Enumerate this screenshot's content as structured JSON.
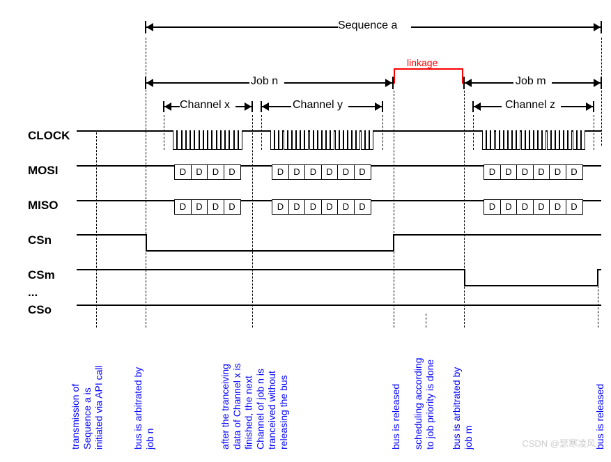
{
  "sequence_label": "Sequence a",
  "job_n_label": "Job n",
  "job_m_label": "Job m",
  "linkage_label": "linkage",
  "channel_x_label": "Channel x",
  "channel_y_label": "Channel y",
  "channel_z_label": "Channel z",
  "signals": {
    "clock": "CLOCK",
    "mosi": "MOSI",
    "miso": "MISO",
    "csn": "CSn",
    "csm": "CSm",
    "ellipsis": "...",
    "cso": "CSo"
  },
  "data_symbol": "D",
  "annotations": {
    "a1": "transmission of\nSequence a is\ninitiated via API call",
    "a2": "bus is arbitrated by\njob n",
    "a3": "after the tranceiving\ndata of Channel x is\nfinished, the next\nChannel of job n is\ntranceived without\nreleasing the bus",
    "a4": "bus is released",
    "a5": "scheduling according\nto job priority is done",
    "a6": "bus is arbitrated by\njob m",
    "a7": "bus is released"
  },
  "watermark": "CSDN @瑟寒凌风",
  "chart_data": {
    "type": "timing-diagram",
    "signals": [
      "CLOCK",
      "MOSI",
      "MISO",
      "CSn",
      "CSm",
      "CSo"
    ],
    "sequence": "Sequence a",
    "jobs": [
      {
        "name": "Job n",
        "channels": [
          "Channel x",
          "Channel y"
        ],
        "cs": "CSn"
      },
      {
        "name": "Job m",
        "channels": [
          "Channel z"
        ],
        "cs": "CSm"
      }
    ],
    "linkage_between": [
      "Job n",
      "Job m"
    ],
    "data_counts": {
      "Channel x": 4,
      "Channel y": 6,
      "Channel z": 6
    },
    "events": [
      "transmission of Sequence a is initiated via API call",
      "bus is arbitrated by job n",
      "after the tranceiving data of Channel x is finished, the next Channel of job n is tranceived without releasing the bus",
      "bus is released",
      "scheduling according to job priority is done",
      "bus is arbitrated by job m",
      "bus is released"
    ]
  }
}
